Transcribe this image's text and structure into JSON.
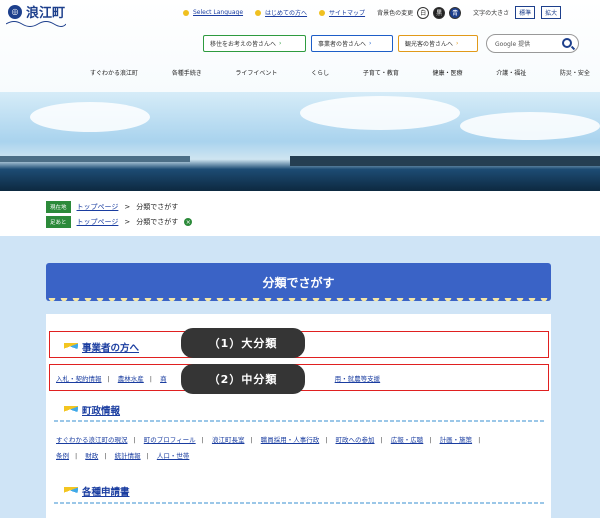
{
  "header": {
    "logo_text": "浪江町",
    "select_language": "Select Language",
    "first_visit": "はじめての方へ",
    "sitemap": "サイトマップ",
    "bg_color_label": "背景色の変更",
    "bg_white": "白",
    "bg_black": "黒",
    "bg_blue": "青",
    "font_size_label": "文字の大きさ",
    "font_standard": "標準",
    "font_large": "拡大",
    "visitor_buttons": [
      "移住をお考えの皆さんへ",
      "事業者の皆さんへ",
      "観光客の皆さんへ"
    ],
    "search_placeholder": "Google 提供"
  },
  "nav": [
    "すぐわかる浪江町",
    "各種手続き",
    "ライフイベント",
    "くらし",
    "子育て・教育",
    "健康・医療",
    "介護・福祉",
    "防災・安全"
  ],
  "breadcrumbs": {
    "current_label": "現在地",
    "footprint_label": "足あと",
    "top_page": "トップページ",
    "separator": ">",
    "current_page": "分類でさがす"
  },
  "main": {
    "page_title": "分類でさがす",
    "sections": [
      {
        "title": "事業者の方へ",
        "links": [
          "入札・契約情報",
          "農林水産",
          "商",
          "用・就農等支援"
        ]
      },
      {
        "title": "町政情報",
        "links": [
          "すぐわかる浪江町の現況",
          "町のプロフィール",
          "浪江町長室",
          "職員採用・人事行政",
          "町政への参加",
          "広報・広聴",
          "計画・施策",
          "条例",
          "財政",
          "統計情報",
          "人口・世帯"
        ]
      },
      {
        "title": "各種申請書",
        "links": []
      }
    ]
  },
  "annotations": {
    "major": "（1）大分類",
    "minor": "（2）中分類"
  },
  "colors": {
    "brand_blue": "#1d3f8c",
    "title_bar": "#3a63c6",
    "annotation_red": "#e02020",
    "badge_green": "#2c8a3a"
  }
}
